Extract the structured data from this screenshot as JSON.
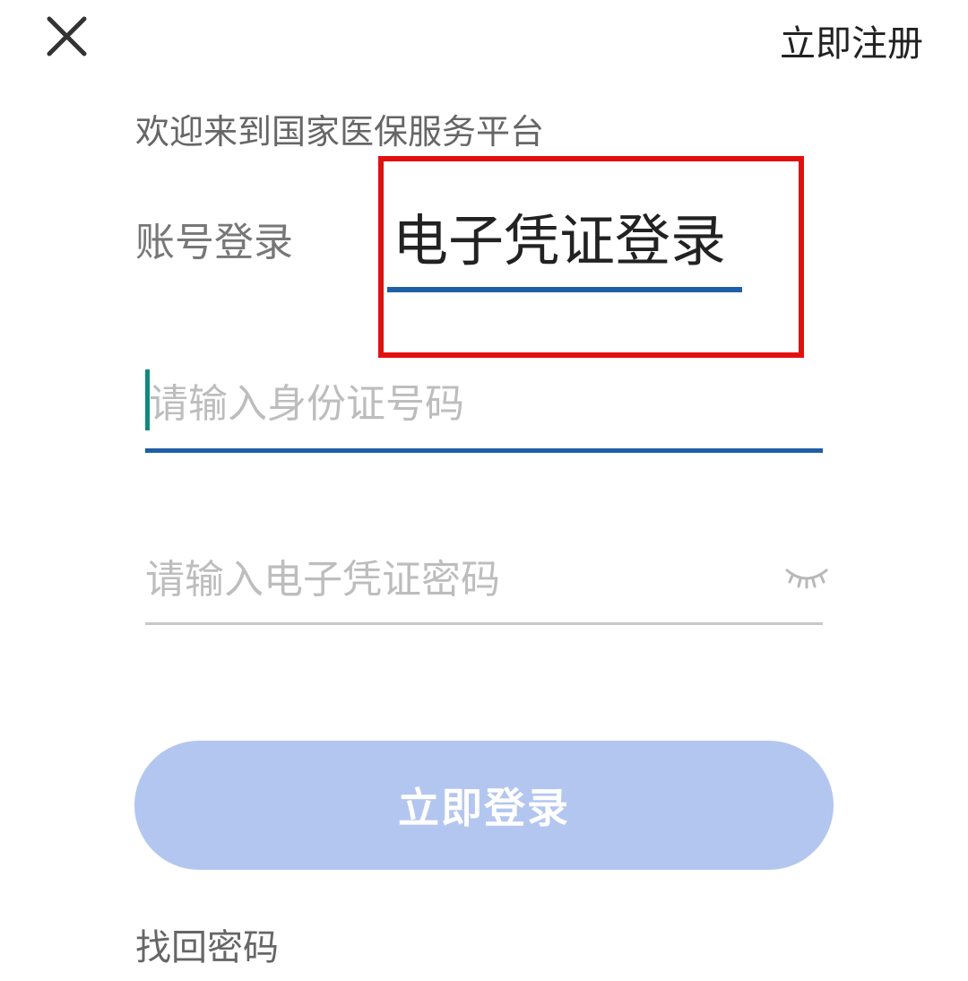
{
  "header": {
    "close_icon": "close-icon",
    "register_label": "立即注册"
  },
  "welcome_text": "欢迎来到国家医保服务平台",
  "tabs": [
    {
      "label": "账号登录",
      "active": false
    },
    {
      "label": "电子凭证登录",
      "active": true
    }
  ],
  "form": {
    "id_placeholder": "请输入身份证号码",
    "id_value": "",
    "password_placeholder": "请输入电子凭证密码",
    "password_value": "",
    "password_toggle_icon": "eye-closed-icon"
  },
  "login_button_label": "立即登录",
  "forgot_password_label": "找回密码",
  "colors": {
    "accent": "#1f5fa6",
    "button_bg": "#b3c6ef",
    "highlight_box": "#e41010",
    "caret": "#0f8a7a"
  }
}
